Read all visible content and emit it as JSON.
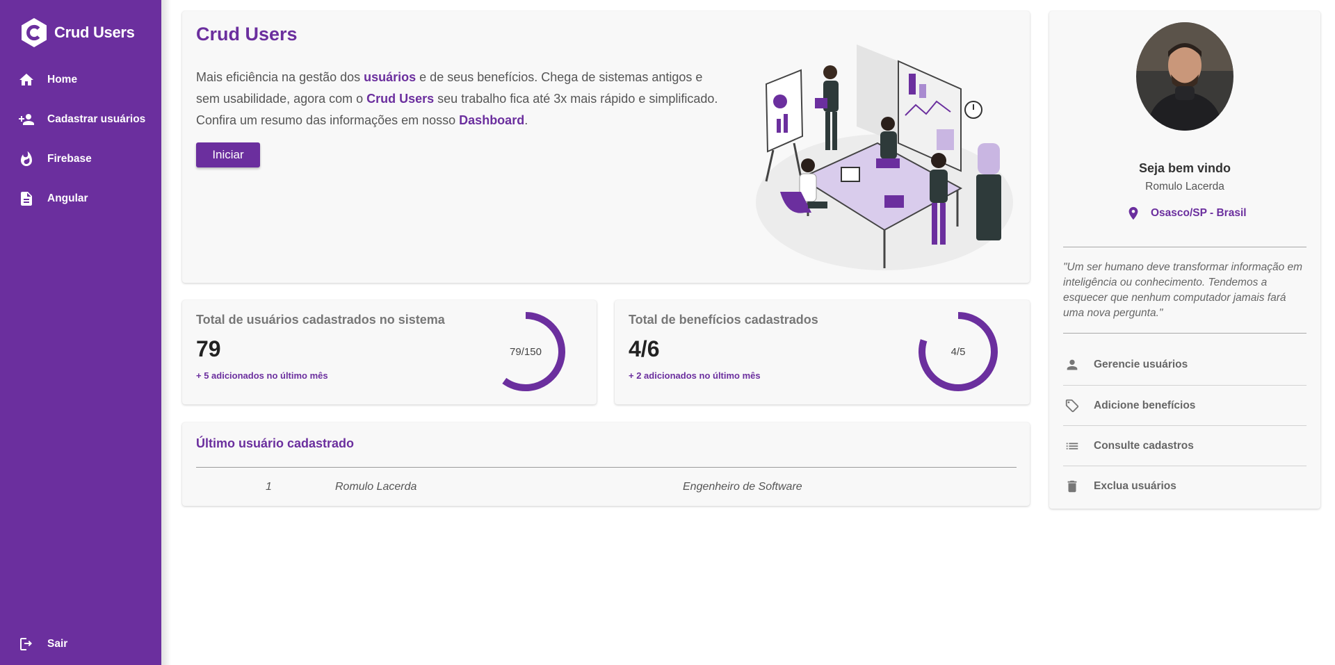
{
  "brand": {
    "name": "Crud Users"
  },
  "sidebar": {
    "items": [
      {
        "label": "Home",
        "icon": "home-icon"
      },
      {
        "label": "Cadastrar usuários",
        "icon": "add-user-icon"
      },
      {
        "label": "Firebase",
        "icon": "flame-icon"
      },
      {
        "label": "Angular",
        "icon": "document-icon"
      }
    ],
    "logout": {
      "label": "Sair",
      "icon": "logout-icon"
    }
  },
  "hero": {
    "title": "Crud Users",
    "text_1": "Mais eficiência na gestão dos ",
    "strong_1": "usuários",
    "text_2": " e de seus benefícios. Chega de sistemas antigos e sem usabilidade, agora com o ",
    "strong_2": "Crud Users",
    "text_3": " seu trabalho fica até 3x mais rápido e simplificado. Confira um resumo das informações em nosso ",
    "strong_3": "Dashboard",
    "text_4": ".",
    "button_label": "Iniciar"
  },
  "stats": [
    {
      "title": "Total de usuários cadastrados no sistema",
      "value": "79",
      "sub": "+ 5 adicionados no último mês",
      "ring_label": "79/150",
      "ring_fraction": 0.6
    },
    {
      "title": "Total de benefícios cadastrados",
      "value": "4/6",
      "sub": "+ 2 adicionados no último mês",
      "ring_label": "4/5",
      "ring_fraction": 0.8
    }
  ],
  "last_user": {
    "title": "Último usuário cadastrado",
    "row": {
      "id": "1",
      "name": "Romulo Lacerda",
      "role": "Engenheiro de Software"
    }
  },
  "profile": {
    "welcome": "Seja bem vindo",
    "name": "Romulo Lacerda",
    "location": "Osasco/SP - Brasil",
    "quote": "\"Um ser humano deve transformar informação em inteligência ou conhecimento. Tendemos a esquecer que nenhum computador jamais fará uma nova pergunta.\"",
    "actions": [
      {
        "label": "Gerencie usuários",
        "icon": "person-icon"
      },
      {
        "label": "Adicione benefícios",
        "icon": "tag-icon"
      },
      {
        "label": "Consulte cadastros",
        "icon": "list-icon"
      },
      {
        "label": "Exclua usuários",
        "icon": "trash-icon"
      }
    ]
  },
  "colors": {
    "primary": "#6b2f9e",
    "card": "#f8f8f8"
  }
}
